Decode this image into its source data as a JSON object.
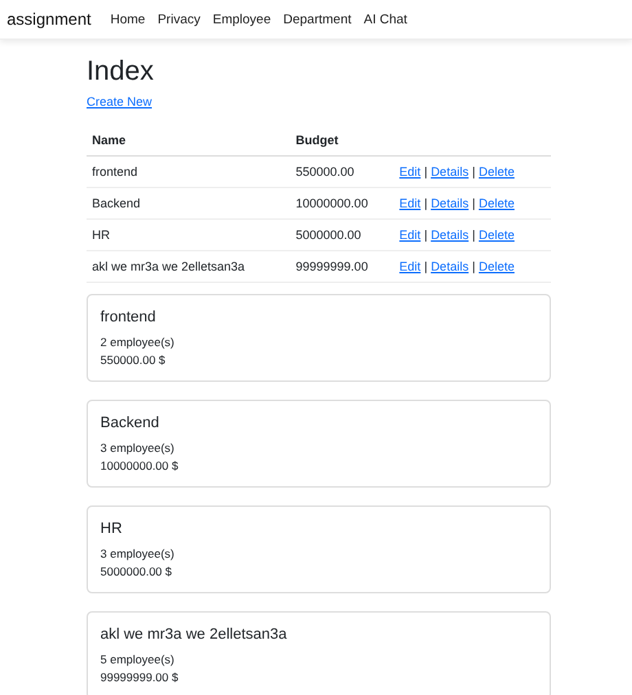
{
  "navbar": {
    "brand": "assignment",
    "links": [
      "Home",
      "Privacy",
      "Employee",
      "Department",
      "AI Chat"
    ]
  },
  "page": {
    "title": "Index",
    "create_link": "Create New"
  },
  "table": {
    "columns": [
      "Name",
      "Budget"
    ],
    "separator": "|",
    "rows": [
      {
        "name": "frontend",
        "budget": "550000.00",
        "actions": [
          "Edit",
          "Details",
          "Delete"
        ]
      },
      {
        "name": "Backend",
        "budget": "10000000.00",
        "actions": [
          "Edit",
          "Details",
          "Delete"
        ]
      },
      {
        "name": "HR",
        "budget": "5000000.00",
        "actions": [
          "Edit",
          "Details",
          "Delete"
        ]
      },
      {
        "name": "akl we mr3a we 2elletsan3a",
        "budget": "99999999.00",
        "actions": [
          "Edit",
          "Details",
          "Delete"
        ]
      }
    ]
  },
  "cards": [
    {
      "title": "frontend",
      "employees": "2 employee(s)",
      "budget": "550000.00 $"
    },
    {
      "title": "Backend",
      "employees": "3 employee(s)",
      "budget": "10000000.00 $"
    },
    {
      "title": "HR",
      "employees": "3 employee(s)",
      "budget": "5000000.00 $"
    },
    {
      "title": "akl we mr3a we 2elletsan3a",
      "employees": "5 employee(s)",
      "budget": "99999999.00 $"
    }
  ]
}
